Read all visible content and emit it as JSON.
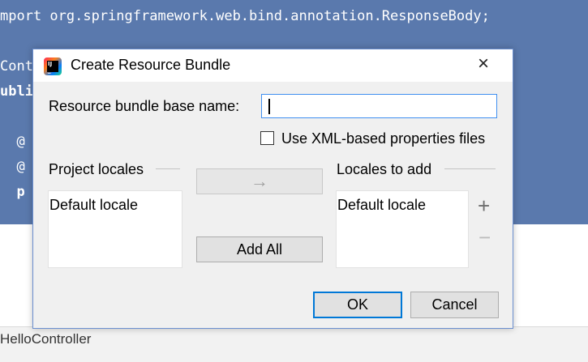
{
  "editor": {
    "lines": [
      "mport org.springframework.web.bind.annotation.ResponseBody;",
      "Cont",
      "ubli",
      "  @",
      "  @",
      "  p"
    ]
  },
  "status_bar": {
    "text": "HelloController"
  },
  "dialog": {
    "title": "Create Resource Bundle",
    "close_icon": "×",
    "base_name_label": "Resource bundle base name:",
    "base_name_value": "",
    "xml_checkbox_label": "Use XML-based properties files",
    "xml_checkbox_checked": false,
    "project_locales_label": "Project locales",
    "project_locales": [
      "Default locale"
    ],
    "move_right_arrow": "→",
    "add_all_label": "Add All",
    "locales_to_add_label": "Locales to add",
    "locales_to_add": [
      "Default locale"
    ],
    "add_icon": "+",
    "remove_icon": "−",
    "ok_label": "OK",
    "cancel_label": "Cancel"
  },
  "colors": {
    "editor_bg": "#5a79ad",
    "dialog_bg": "#f0f0f0",
    "focus_border": "#3f8ef0",
    "default_button_border": "#0078d7"
  }
}
